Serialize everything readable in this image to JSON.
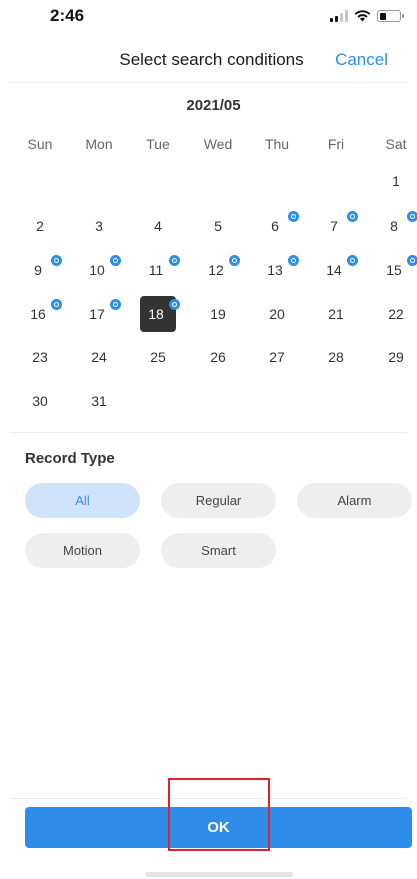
{
  "status_bar": {
    "time": "2:46",
    "battery_level": 0.35
  },
  "header": {
    "title": "Select search conditions",
    "cancel_label": "Cancel"
  },
  "calendar": {
    "month": "2021/05",
    "weekdays": [
      "Sun",
      "Mon",
      "Tue",
      "Wed",
      "Thu",
      "Fri",
      "Sat"
    ],
    "first_weekday_index": 6,
    "days_in_month": 31,
    "selected_day": 18,
    "recorded_days": [
      6,
      7,
      8,
      9,
      10,
      11,
      12,
      13,
      14,
      15,
      16,
      17,
      18
    ]
  },
  "record_type": {
    "title": "Record Type",
    "options": [
      "All",
      "Regular",
      "Alarm",
      "Motion",
      "Smart"
    ],
    "selected": "All"
  },
  "footer": {
    "ok_label": "OK"
  },
  "colors": {
    "accent": "#2e8de8",
    "selected_day_bg": "#333333",
    "highlight_box": "#e0202a"
  }
}
